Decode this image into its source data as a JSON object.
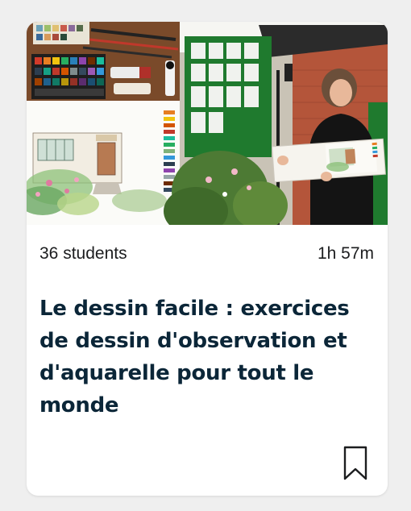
{
  "course": {
    "students": "36 students",
    "duration": "1h 57m",
    "title": "Le dessin facile : exercices de dessin d'observation et d'aquarelle pour tout le monde"
  },
  "icons": {
    "bookmark": "bookmark-icon"
  },
  "colors": {
    "title": "#0b2638",
    "meta_text": "#1c1d1f",
    "card_bg": "#ffffff",
    "page_bg": "#efefef",
    "window_green": "#2f8a3a"
  }
}
